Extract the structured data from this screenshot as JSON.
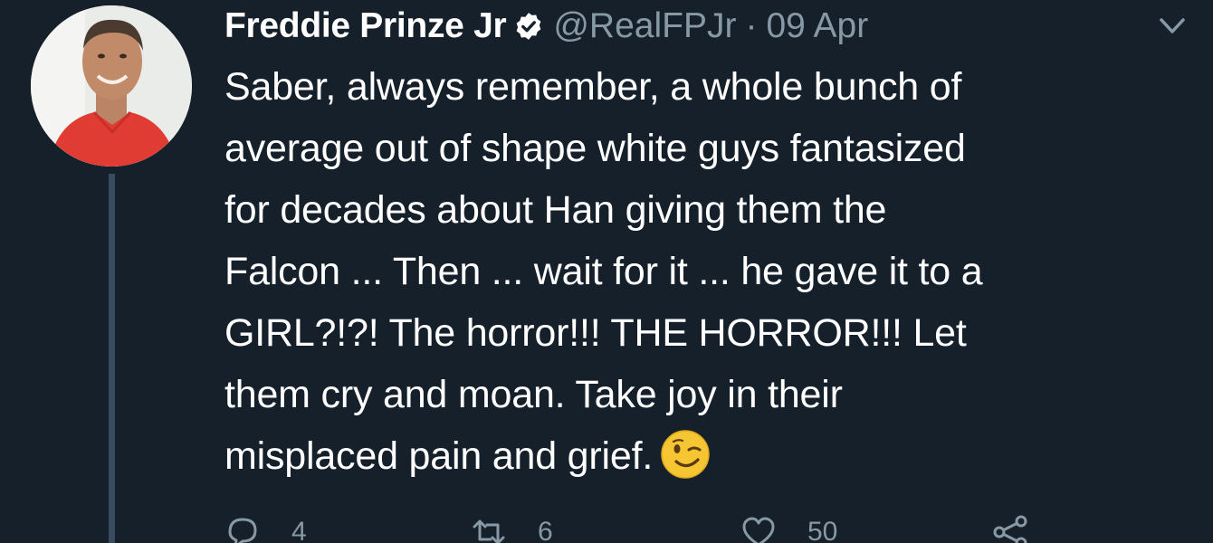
{
  "tweet": {
    "author_name": "Freddie Prinze Jr",
    "handle": "@RealFPJr",
    "separator": "·",
    "date": "09 Apr",
    "body_lines": [
      "Saber, always remember, a whole bunch of",
      "average out of shape white guys fantasized",
      "for decades about Han giving them the",
      "Falcon ... Then ... wait for it ... he gave it to a",
      "GIRL?!?! The horror!!! THE HORROR!!! Let",
      "them cry and moan. Take joy in their",
      "misplaced pain and grief."
    ],
    "emoji": "winking-face",
    "actions": {
      "reply_count": "4",
      "retweet_count": "6",
      "like_count": "50"
    }
  },
  "colors": {
    "background": "#15202b",
    "text": "#ffffff",
    "secondary": "#8899a6",
    "thread_line": "#394b5e"
  }
}
